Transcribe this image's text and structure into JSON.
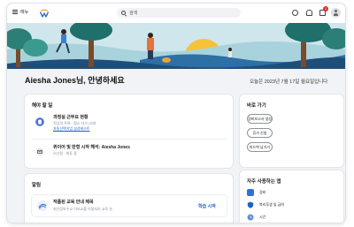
{
  "topbar": {
    "menu_label": "메뉴",
    "search_placeholder": "검색",
    "notification_count": "1"
  },
  "greeting": {
    "name_line": "Aiesha Jones님, 안녕하세요",
    "date_line": "오늘은 2023년 7월 17일 월요일입니다"
  },
  "todo": {
    "title": "해야 할 일",
    "tasks": [
      {
        "title": "과정실 근무요 현황",
        "subtitle": "직업의 목록 · 협소 자가 (오파",
        "link": "자동선택기업 삼성테스트"
      },
      {
        "title": "퀴이어 및 만형 시작 해석: Aiesha Jones",
        "subtitle": "오산됨 · 회동 중"
      }
    ]
  },
  "alerts": {
    "title": "알림",
    "items": [
      {
        "title": "작품된 교육 안내 제목",
        "subtitle": "최선정보수교 이보교를 이탈지리 교육 온",
        "action": "학습 시작"
      }
    ]
  },
  "shortcuts": {
    "title": "바로 가기",
    "buttons": [
      "경비보고서 생성",
      "휴가 신청",
      "피드백 남기기"
    ]
  },
  "frequent": {
    "title": "자주 사용하는 앱",
    "items": [
      {
        "label": "경비",
        "icon": "expense-icon",
        "color": "#2f6fd6"
      },
      {
        "label": "복리후생 및 급여",
        "icon": "benefits-shield-icon",
        "color": "#1b62c9"
      },
      {
        "label": "시간",
        "icon": "time-icon",
        "color": "#5b8fd9"
      }
    ]
  },
  "colors": {
    "accent": "#1b62c9",
    "task1_icon": "#5477d6",
    "badge": "#d32f2f"
  }
}
